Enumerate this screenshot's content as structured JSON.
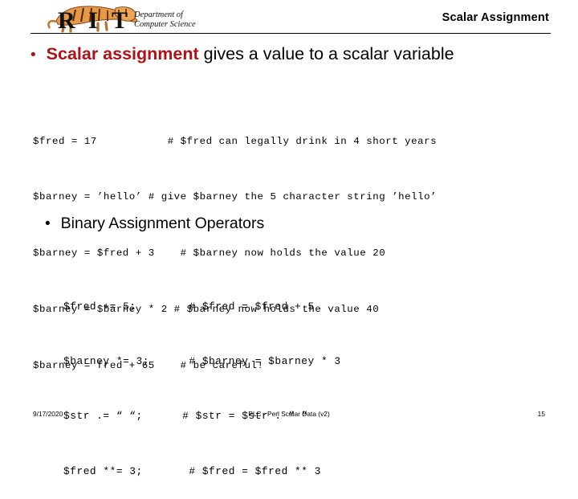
{
  "header": {
    "logo_alt": "RIT tiger logo",
    "dept_line_1": "Department of",
    "dept_line_2": "Computer Science",
    "title": "Scalar Assignment"
  },
  "colors": {
    "accent_red": "#b01117",
    "text": "#000000",
    "background": "#ffffff",
    "tiger_orange": "#e08a33",
    "tiger_dark": "#7a3a10"
  },
  "bullets": [
    {
      "marker": "•",
      "marker_color": "#b01117",
      "emphasis": "Scalar assignment",
      "rest": " gives a value to a scalar variable"
    },
    {
      "marker": "•",
      "marker_color": "#000000",
      "text": "Binary Assignment Operators"
    }
  ],
  "code_block_1": {
    "lines": [
      "$fred = 17           # $fred can legally drink in 4 short years",
      "$barney = ’hello’ # give $barney the 5 character string ’hello’",
      "$barney = $fred + 3    # $barney now holds the value 20",
      "$barney = $barney * 2 # $barney now holds the value 40",
      "$barney = fred + 65    # be careful!"
    ]
  },
  "code_block_2": {
    "lines": [
      "$fred += 5;        # $fred = $fred + 5",
      "$barney *= 3;      # $barney = $barney * 3",
      "$str .= “ “;      # $str = $str . “ “",
      "$fred **= 3;       # $fred = $fred ** 3"
    ]
  },
  "footer": {
    "date": "9/17/2020",
    "center": "PLC - Perl Scalar Data (v2)",
    "page": "15"
  }
}
